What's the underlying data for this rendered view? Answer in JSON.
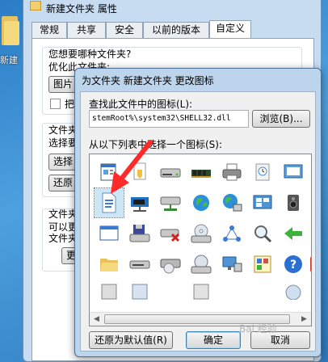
{
  "desktop": {
    "folder_label": "新建"
  },
  "properties_window": {
    "title": "新建文件夹 属性",
    "tabs": [
      {
        "label": "常规"
      },
      {
        "label": "共享"
      },
      {
        "label": "安全"
      },
      {
        "label": "以前的版本"
      },
      {
        "label": "自定义"
      }
    ],
    "active_tab": "自定义",
    "section1_title": "您想要哪种文件夹?",
    "section1_sub": "优化此文件夹:",
    "section1_button": "图片",
    "section1_check": "把",
    "section2_title": "文件夹",
    "section2_sub": "选择要",
    "section2_btn1": "选择",
    "section2_btn2": "还原",
    "section3_title": "文件夹",
    "section3_sub1": "可以更",
    "section3_sub2": "文件夹",
    "section3_btn": "更改"
  },
  "dialog": {
    "title": "为文件夹 新建文件夹 更改图标",
    "find_label": "查找此文件中的图标(L):",
    "path_value": "stemRoot%\\system32\\SHELL32.dll",
    "browse_button": "浏览(B)...",
    "list_label": "从以下列表中选择一个图标(S):",
    "restore_button": "还原为默认值(R)",
    "ok_button": "确定",
    "cancel_button": "取消",
    "selected_icon": "document-icon"
  },
  "watermark": "Bai 经验"
}
